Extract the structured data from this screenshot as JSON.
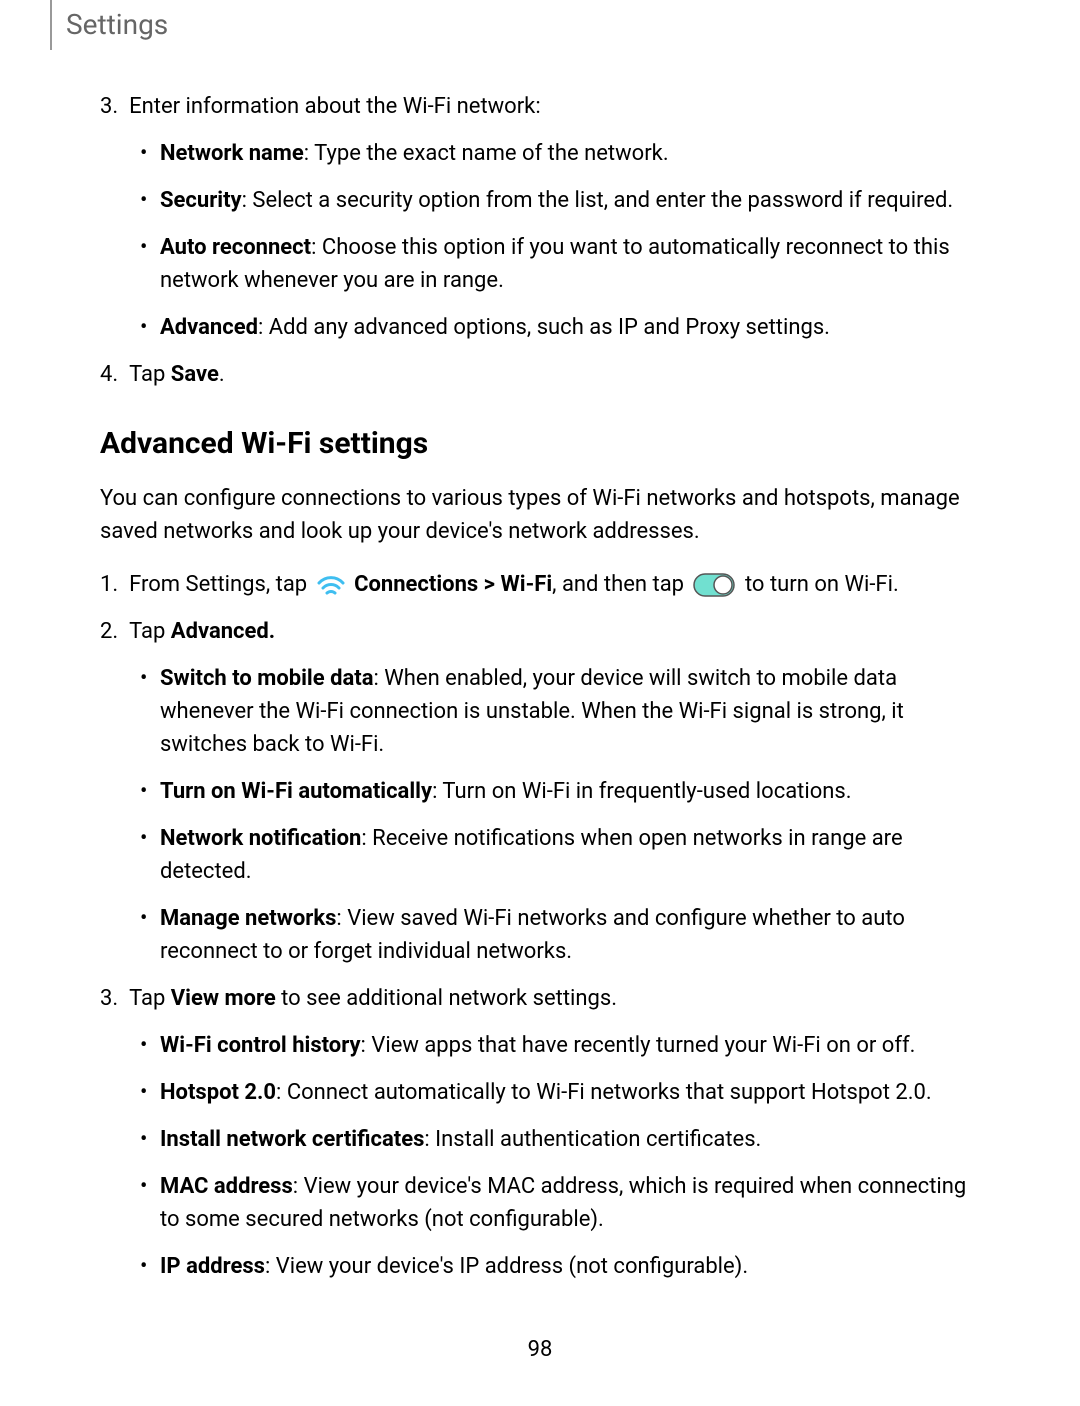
{
  "header": {
    "title": "Settings"
  },
  "step3": {
    "number": "3.",
    "text": "Enter information about the Wi-Fi network:",
    "items": [
      {
        "label": "Network name",
        "desc": ": Type the exact name of the network."
      },
      {
        "label": "Security",
        "desc": ": Select a security option from the list, and enter the password if required."
      },
      {
        "label": "Auto reconnect",
        "desc": ": Choose this option if you want to automatically reconnect to this network whenever you are in range."
      },
      {
        "label": "Advanced",
        "desc": ": Add any advanced options, such as IP and Proxy settings."
      }
    ]
  },
  "step4": {
    "number": "4.",
    "text": "Tap ",
    "bold": "Save",
    "suffix": "."
  },
  "section": {
    "heading": "Advanced Wi-Fi settings",
    "intro": "You can configure connections to various types of Wi-Fi networks and hotspots, manage saved networks and look up your device's network addresses."
  },
  "adv_step1": {
    "number": "1.",
    "pre": "From Settings, tap ",
    "connections": "Connections",
    "arrow": " > ",
    "wifi": "Wi-Fi",
    "mid": ", and then tap ",
    "post": " to turn on Wi-Fi."
  },
  "adv_step2": {
    "number": "2.",
    "text": "Tap ",
    "bold": "Advanced.",
    "items": [
      {
        "label": "Switch to mobile data",
        "desc": ": When enabled, your device will switch to mobile data whenever the Wi-Fi connection is unstable. When the Wi-Fi signal is strong, it switches back to Wi-Fi."
      },
      {
        "label": "Turn on Wi-Fi automatically",
        "desc": ": Turn on Wi-Fi in frequently-used locations."
      },
      {
        "label": "Network notification",
        "desc": ": Receive notifications when open networks in range are detected."
      },
      {
        "label": "Manage networks",
        "desc": ": View saved Wi-Fi networks and configure whether to auto reconnect to or forget individual networks."
      }
    ]
  },
  "adv_step3": {
    "number": "3.",
    "text": "Tap ",
    "bold": "View more",
    "suffix": " to see additional network settings.",
    "items": [
      {
        "label": "Wi-Fi control history",
        "desc": ": View apps that have recently turned your Wi-Fi on or off."
      },
      {
        "label": "Hotspot 2.0",
        "desc": ": Connect automatically to Wi-Fi networks that support Hotspot 2.0."
      },
      {
        "label": "Install network certificates",
        "desc": ": Install authentication certificates."
      },
      {
        "label": "MAC address",
        "desc": ": View your device's MAC address, which is required when connecting to some secured networks (not configurable)."
      },
      {
        "label": "IP address",
        "desc": ": View your device's IP address (not configurable)."
      }
    ]
  },
  "page_number": "98"
}
